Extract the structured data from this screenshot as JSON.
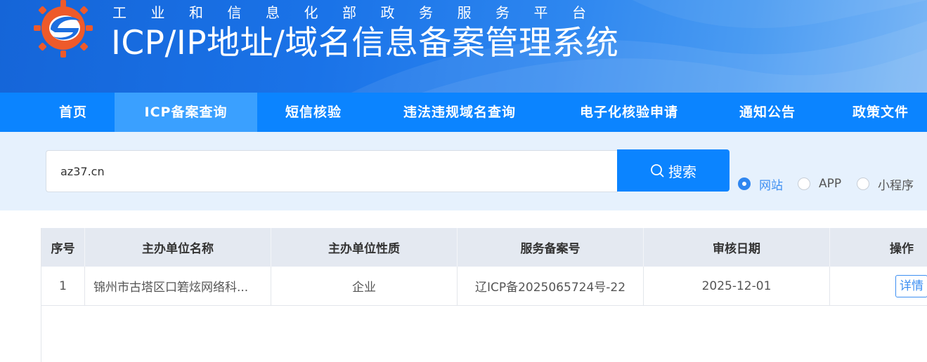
{
  "header": {
    "subtitle_chars": [
      "工",
      "业",
      "和",
      "信",
      "息",
      "化",
      "部",
      "政",
      "务",
      "服",
      "务",
      "平",
      "台"
    ],
    "title": "ICP/IP地址/域名信息备案管理系统",
    "logo": "miit-gear-logo-icon",
    "colors": {
      "banner": "#1a73e8",
      "logo_orange": "#ee5a2a",
      "logo_blue": "#1c6fe0"
    }
  },
  "nav": {
    "items": [
      {
        "label": "首页",
        "active": false
      },
      {
        "label": "ICP备案查询",
        "active": true
      },
      {
        "label": "短信核验",
        "active": false
      },
      {
        "label": "违法违规域名查询",
        "active": false
      },
      {
        "label": "电子化核验申请",
        "active": false
      },
      {
        "label": "通知公告",
        "active": false
      },
      {
        "label": "政策文件",
        "active": false
      }
    ],
    "colors": {
      "bar": "#0b84ff",
      "active": "#3aa0ff"
    }
  },
  "search": {
    "value": "az37.cn",
    "button_label": "搜索",
    "button_icon": "search-icon",
    "types": [
      {
        "label": "网站",
        "checked": true
      },
      {
        "label": "APP",
        "checked": false
      },
      {
        "label": "小程序",
        "checked": false
      }
    ]
  },
  "table": {
    "columns": [
      "序号",
      "主办单位名称",
      "主办单位性质",
      "服务备案号",
      "审核日期",
      "操作"
    ],
    "rows": [
      {
        "index": "1",
        "org_name": "锦州市古塔区口箬炫网络科...",
        "org_type": "企业",
        "record_no": "辽ICP备2025065724号-22",
        "date": "2025-12-01",
        "action": "详情"
      }
    ]
  }
}
